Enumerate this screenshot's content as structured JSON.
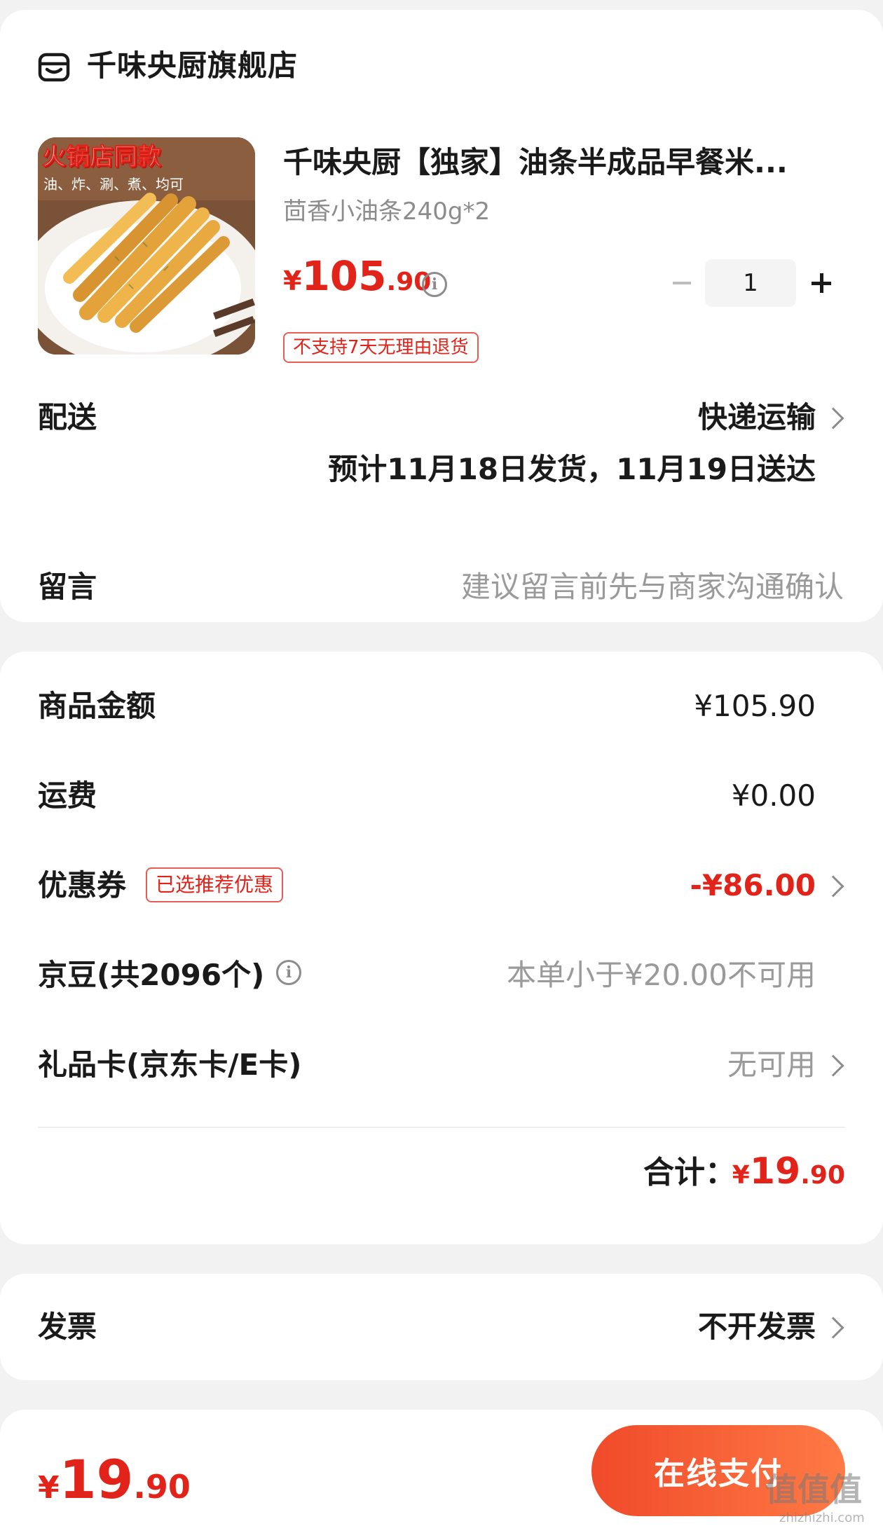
{
  "store": {
    "name": "千味央厨旗舰店",
    "icon": "store-icon"
  },
  "product": {
    "image_banner": "火锅店同款",
    "image_caption": "油、炸、涮、煮、均可",
    "title": "千味央厨【独家】油条半成品早餐米...",
    "spec": "茴香小油条240g*2",
    "price_symbol": "¥",
    "price_int": "105",
    "price_dec": ".90",
    "quantity": "1",
    "no_return_badge": "不支持7天无理由退货"
  },
  "delivery": {
    "label": "配送",
    "method": "快递运输",
    "eta": "预计11月18日发货，11月19日送达"
  },
  "message": {
    "label": "留言",
    "placeholder": "建议留言前先与商家沟通确认"
  },
  "amounts": {
    "goods_label": "商品金额",
    "goods_value": "¥105.90",
    "shipping_label": "运费",
    "shipping_value": "¥0.00",
    "coupon_label": "优惠券",
    "coupon_badge": "已选推荐优惠",
    "coupon_value": "-¥86.00",
    "beans_label": "京豆(共2096个)",
    "beans_value": "本单小于¥20.00不可用",
    "giftcard_label": "礼品卡(京东卡/E卡)",
    "giftcard_value": "无可用",
    "total_label": "合计：",
    "total_symbol": "¥",
    "total_int": "19",
    "total_dec": ".90"
  },
  "invoice": {
    "label": "发票",
    "value": "不开发票"
  },
  "bottom_bar": {
    "price_symbol": "¥",
    "price_int": "19",
    "price_dec": ".90",
    "pay_button": "在线支付",
    "watermark": "值值值",
    "watermark_sub": "zhizhizhi.com"
  },
  "colors": {
    "accent": "#e2231a",
    "muted": "#8c8c8c",
    "background": "#f2f2f2"
  }
}
